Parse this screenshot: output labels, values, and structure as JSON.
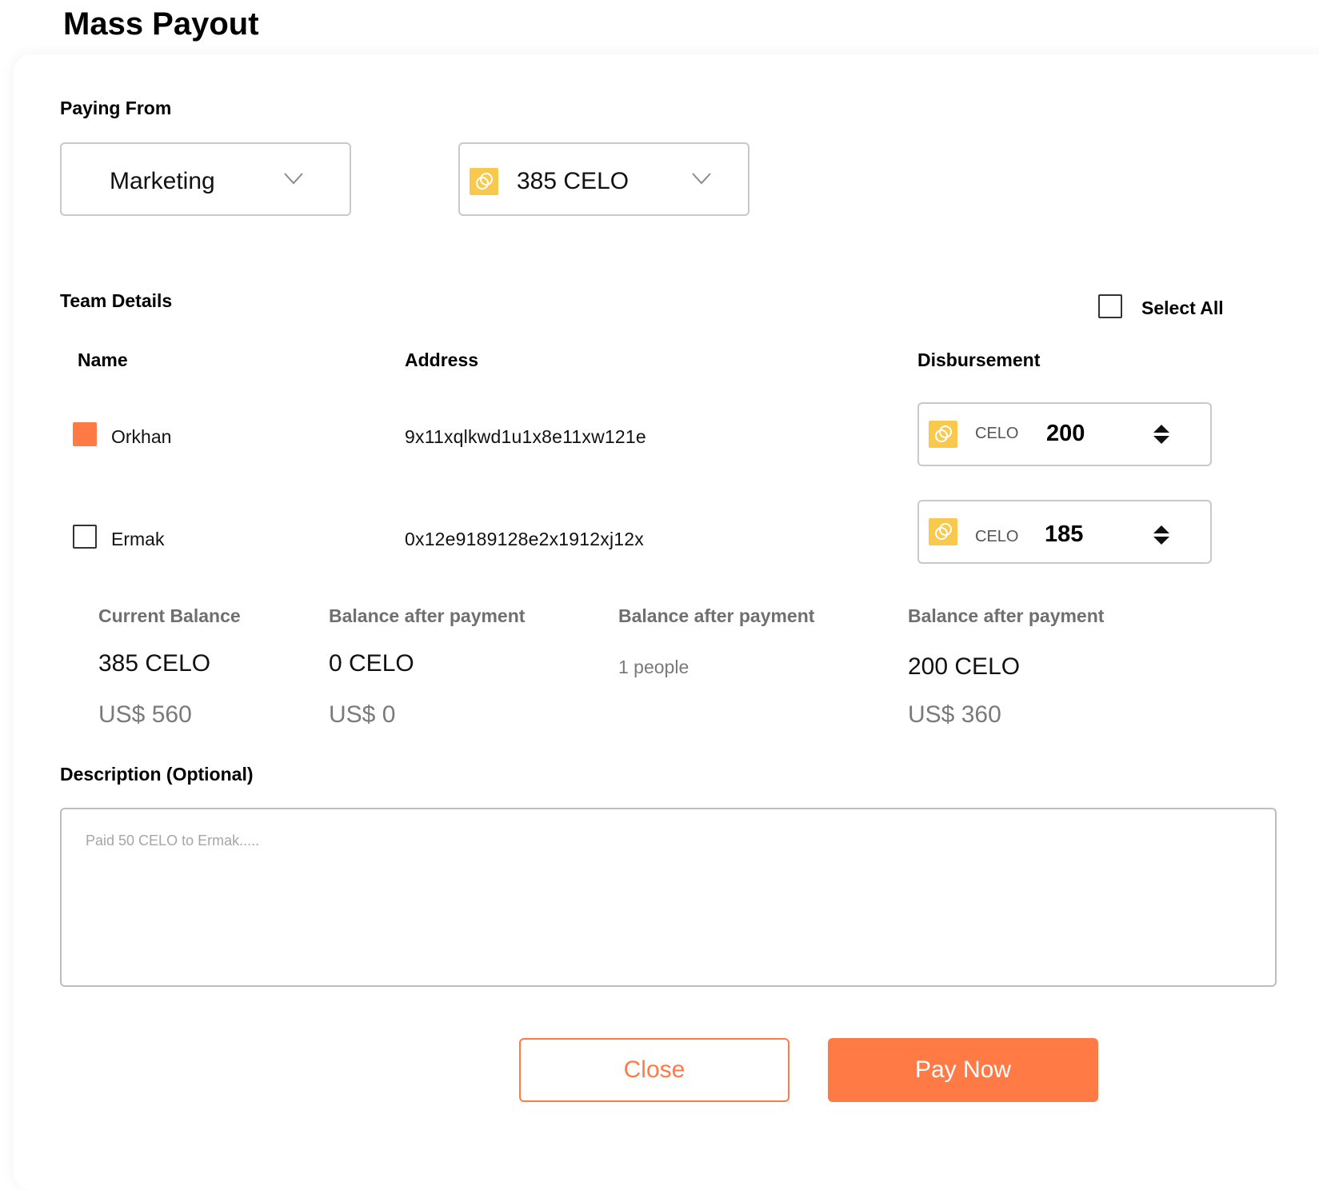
{
  "header": {
    "title": "Mass Payout"
  },
  "paying_from": {
    "label": "Paying From",
    "account": "Marketing",
    "balance": "385 CELO"
  },
  "team": {
    "title": "Team Details",
    "select_all_label": "Select All",
    "select_all_checked": false,
    "columns": {
      "name": "Name",
      "address": "Address",
      "disbursement": "Disbursement"
    },
    "members": [
      {
        "name": "Orkhan",
        "address": "9x11xqlkwd1u1x8e11xw121e",
        "unit": "CELO",
        "amount": "200",
        "checked": true
      },
      {
        "name": "Ermak",
        "address": "0x12e9189128e2x1912xj12x",
        "unit": "CELO",
        "amount": "185",
        "checked": false
      }
    ]
  },
  "summary": {
    "current_balance": {
      "label": "Current Balance",
      "value": "385 CELO",
      "usd": "US$ 560"
    },
    "after_payment_1": {
      "label": "Balance after payment",
      "value": "0 CELO",
      "usd": "US$ 0"
    },
    "after_payment_2": {
      "label": "Balance after payment",
      "people": "1 people"
    },
    "after_payment_3": {
      "label": "Balance after payment",
      "value": "200 CELO",
      "usd": "US$ 360"
    }
  },
  "description": {
    "label": "Description (Optional)",
    "placeholder": "Paid 50 CELO to Ermak....."
  },
  "actions": {
    "close": "Close",
    "pay": "Pay Now"
  },
  "icons": {
    "coin": "celo-coin-icon",
    "dropdown": "chevron-down-icon",
    "stepper": "sort-stepper-icon"
  },
  "colors": {
    "accent": "#FF7A45",
    "coin": "#F8C94C",
    "border": "#C9C9C9",
    "muted_text": "#7A7A7A"
  }
}
